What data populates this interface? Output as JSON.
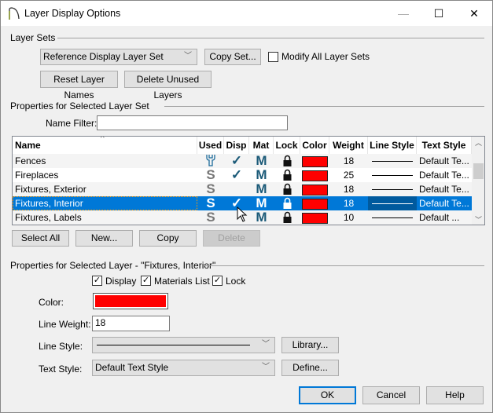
{
  "window": {
    "title": "Layer Display Options",
    "minimize": "—",
    "maximize": "☐",
    "close": "✕"
  },
  "layer_sets": {
    "label": "Layer Sets",
    "selected_set": "Reference Display Layer Set",
    "copy_set": "Copy Set...",
    "modify_all": "Modify All Layer Sets",
    "modify_all_checked": false,
    "reset_names": "Reset Layer Names",
    "delete_unused": "Delete Unused Layers"
  },
  "set_props": {
    "label": "Properties for Selected Layer Set",
    "name_filter_label": "Name Filter:",
    "name_filter_value": ""
  },
  "table": {
    "columns": [
      "Name",
      "Used",
      "Disp",
      "Mat",
      "Lock",
      "Color",
      "Weight",
      "Line Style",
      "Text Style"
    ],
    "rows": [
      {
        "name": "Fences",
        "used": "wrench",
        "disp": true,
        "mat": "M",
        "lock": "locked",
        "color": "#ff0000",
        "weight": "18",
        "text_style": "Default Te..."
      },
      {
        "name": "Fireplaces",
        "used": "S",
        "disp": true,
        "mat": "M",
        "lock": "locked",
        "color": "#ff0000",
        "weight": "25",
        "text_style": "Default Te..."
      },
      {
        "name": "Fixtures, Exterior",
        "used": "S",
        "disp": false,
        "mat": "M",
        "lock": "locked",
        "color": "#ff0000",
        "weight": "18",
        "text_style": "Default Te..."
      },
      {
        "name": "Fixtures, Interior",
        "used": "S",
        "disp": true,
        "mat": "M",
        "lock": "locked",
        "color": "#ff0000",
        "weight": "18",
        "text_style": "Default Te...",
        "selected": true
      },
      {
        "name": "Fixtures, Labels",
        "used": "S",
        "disp": false,
        "mat": "M",
        "lock": "locked",
        "color": "#ff0000",
        "weight": "10",
        "text_style": "Default ..."
      }
    ]
  },
  "table_buttons": {
    "select_all": "Select All",
    "new": "New...",
    "copy": "Copy",
    "delete": "Delete"
  },
  "layer_props": {
    "label": "Properties for Selected Layer - \"Fixtures, Interior\"",
    "display": "Display",
    "materials_list": "Materials List",
    "lock": "Lock",
    "check": "✓",
    "color_label": "Color:",
    "color": "#ff0000",
    "line_weight_label": "Line Weight:",
    "line_weight": "18",
    "line_style_label": "Line Style:",
    "library": "Library...",
    "text_style_label": "Text Style:",
    "text_style": "Default Text Style",
    "define": "Define..."
  },
  "footer": {
    "ok": "OK",
    "cancel": "Cancel",
    "help": "Help"
  }
}
